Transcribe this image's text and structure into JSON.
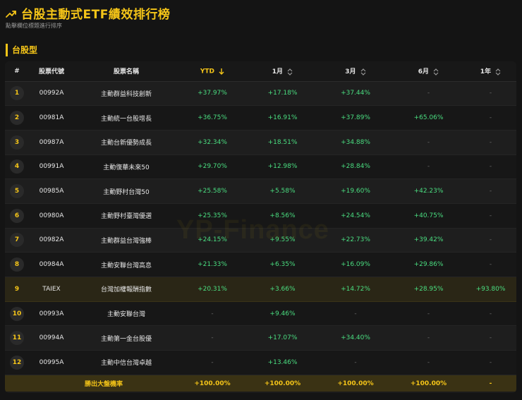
{
  "header": {
    "title": "台股主動式ETF績效排行榜",
    "subtitle": "點擊欄位標題進行排序",
    "icon": "trend-up-icon"
  },
  "section": {
    "title": "台股型"
  },
  "colors": {
    "accent": "#f5c518",
    "positive": "#4ade80",
    "dash": "#6b6b6b"
  },
  "table": {
    "columns": {
      "rank": "#",
      "code": "股票代號",
      "name": "股票名稱",
      "ytd": "YTD",
      "m1": "1月",
      "m3": "3月",
      "m6": "6月",
      "y1": "1年"
    },
    "sorted_column": "ytd",
    "rows": [
      {
        "rank": "1",
        "code": "00992A",
        "name": "主動群益科技創新",
        "ytd": "+37.97%",
        "m1": "+17.18%",
        "m3": "+37.44%",
        "m6": "-",
        "y1": "-"
      },
      {
        "rank": "2",
        "code": "00981A",
        "name": "主動統一台股增長",
        "ytd": "+36.75%",
        "m1": "+16.91%",
        "m3": "+37.89%",
        "m6": "+65.06%",
        "y1": "-"
      },
      {
        "rank": "3",
        "code": "00987A",
        "name": "主動台新優勢成長",
        "ytd": "+32.34%",
        "m1": "+18.51%",
        "m3": "+34.88%",
        "m6": "-",
        "y1": "-"
      },
      {
        "rank": "4",
        "code": "00991A",
        "name": "主動復華未來50",
        "ytd": "+29.70%",
        "m1": "+12.98%",
        "m3": "+28.84%",
        "m6": "-",
        "y1": "-"
      },
      {
        "rank": "5",
        "code": "00985A",
        "name": "主動野村台灣50",
        "ytd": "+25.58%",
        "m1": "+5.58%",
        "m3": "+19.60%",
        "m6": "+42.23%",
        "y1": "-"
      },
      {
        "rank": "6",
        "code": "00980A",
        "name": "主動野村臺灣優選",
        "ytd": "+25.35%",
        "m1": "+8.56%",
        "m3": "+24.54%",
        "m6": "+40.75%",
        "y1": "-"
      },
      {
        "rank": "7",
        "code": "00982A",
        "name": "主動群益台灣強棒",
        "ytd": "+24.15%",
        "m1": "+9.55%",
        "m3": "+22.73%",
        "m6": "+39.42%",
        "y1": "-"
      },
      {
        "rank": "8",
        "code": "00984A",
        "name": "主動安聯台灣高息",
        "ytd": "+21.33%",
        "m1": "+6.35%",
        "m3": "+16.09%",
        "m6": "+29.86%",
        "y1": "-"
      },
      {
        "rank": "9",
        "code": "TAIEX",
        "name": "台灣加權報酬指數",
        "ytd": "+20.31%",
        "m1": "+3.66%",
        "m3": "+14.72%",
        "m6": "+28.95%",
        "y1": "+93.80%",
        "benchmark": true
      },
      {
        "rank": "10",
        "code": "00993A",
        "name": "主動安聯台灣",
        "ytd": "-",
        "m1": "+9.46%",
        "m3": "-",
        "m6": "-",
        "y1": "-"
      },
      {
        "rank": "11",
        "code": "00994A",
        "name": "主動第一金台股優",
        "ytd": "-",
        "m1": "+17.07%",
        "m3": "+34.40%",
        "m6": "-",
        "y1": "-"
      },
      {
        "rank": "12",
        "code": "00995A",
        "name": "主動中信台灣卓越",
        "ytd": "-",
        "m1": "+13.46%",
        "m3": "-",
        "m6": "-",
        "y1": "-"
      }
    ],
    "footer": {
      "label": "勝出大盤機率",
      "ytd": "+100.00%",
      "m1": "+100.00%",
      "m3": "+100.00%",
      "m6": "+100.00%",
      "y1": "-"
    }
  },
  "watermark": "YP-Finance"
}
